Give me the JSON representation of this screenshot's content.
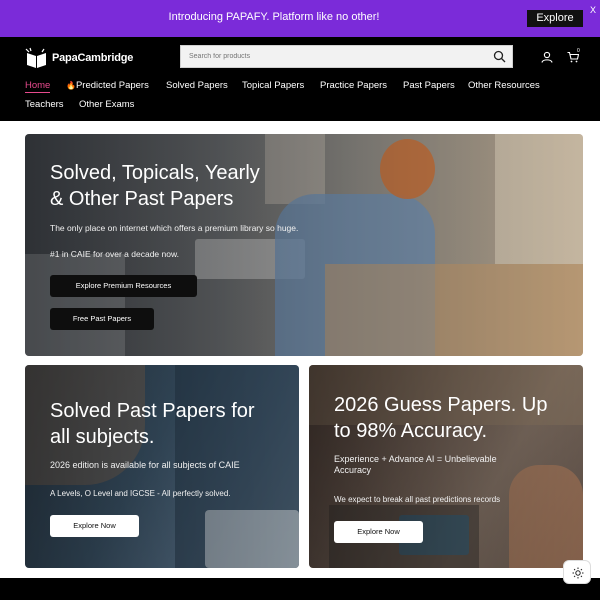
{
  "promo": {
    "text": "Introducing PAPAFY. Platform like no other!",
    "button_label": "Explore",
    "close_label": "X"
  },
  "header": {
    "logo_text": "PapaCambridge",
    "search_placeholder": "Search for products",
    "cart_count": "0"
  },
  "nav": {
    "items": [
      {
        "label": "Home"
      },
      {
        "label": "Predicted Papers",
        "icon": "fire-icon"
      },
      {
        "label": "Solved Papers"
      },
      {
        "label": "Topical Papers"
      },
      {
        "label": "Practice Papers"
      },
      {
        "label": "Past Papers"
      },
      {
        "label": "Other Resources"
      },
      {
        "label": "Teachers"
      },
      {
        "label": "Other Exams"
      }
    ]
  },
  "hero": {
    "title_line1": "Solved, Topicals, Yearly",
    "title_line2": "& Other Past Papers",
    "subtitle": "The only place on internet which offers a premium library so huge.",
    "tagline": "#1 in CAIE for over a decade now.",
    "primary_button": "Explore Premium Resources",
    "secondary_button": "Free Past Papers"
  },
  "card_solved": {
    "title_line1": "Solved Past Papers for",
    "title_line2": "all subjects.",
    "subtitle": "2026 edition is available for all subjects of CAIE",
    "note": "A Levels, O Level and IGCSE - All perfectly solved.",
    "button": "Explore Now"
  },
  "card_guess": {
    "title_line1": "2026 Guess Papers. Up",
    "title_line2": "to 98% Accuracy.",
    "subtitle_line1": "Experience + Advance AI = Unbelievable",
    "subtitle_line2": "Accuracy",
    "note": "We expect to break all past predictions records",
    "button": "Explore Now"
  },
  "colors": {
    "promo_bg": "#7b2bd9",
    "header_bg": "#000000",
    "nav_active": "#e74a8d"
  }
}
